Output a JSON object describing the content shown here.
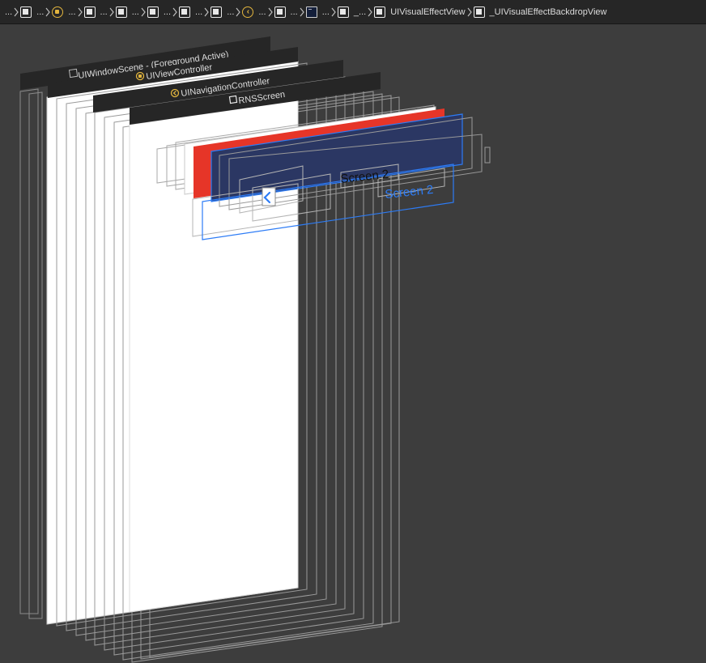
{
  "breadcrumb": {
    "items": [
      {
        "label": "...",
        "icon": "view-icon"
      },
      {
        "label": "...",
        "icon": "view-icon"
      },
      {
        "label": "...",
        "icon": "view-controller-icon"
      },
      {
        "label": "...",
        "icon": "view-icon"
      },
      {
        "label": "...",
        "icon": "view-icon"
      },
      {
        "label": "...",
        "icon": "view-icon"
      },
      {
        "label": "...",
        "icon": "view-icon"
      },
      {
        "label": "...",
        "icon": "view-icon"
      },
      {
        "label": "...",
        "icon": "navigation-controller-icon"
      },
      {
        "label": "...",
        "icon": "view-icon"
      },
      {
        "label": "...",
        "icon": "layer-icon"
      },
      {
        "label": "_...",
        "icon": "view-icon"
      },
      {
        "label": "UIVisualEffectView",
        "icon": "view-icon"
      },
      {
        "label": "_UIVisualEffectBackdropView",
        "icon": "view-icon"
      }
    ]
  },
  "hierarchy": {
    "window_scene": "UIWindowScene - (Foreground Active)",
    "view_controller": "UIViewController",
    "navigation_controller": "UINavigationController",
    "rns_screen": "RNSScreen"
  },
  "navbar": {
    "title": "Screen 2",
    "back_title": "Screen 2",
    "back_chevron": "chevron-left-icon"
  },
  "colors": {
    "canvas_bg": "#3d3d3d",
    "header_bg": "#262626",
    "accent_red": "#e63528",
    "selection_blue": "#2d7cf6",
    "selected_fill": "#2b3763",
    "icon_yellow": "#e2b53e"
  }
}
